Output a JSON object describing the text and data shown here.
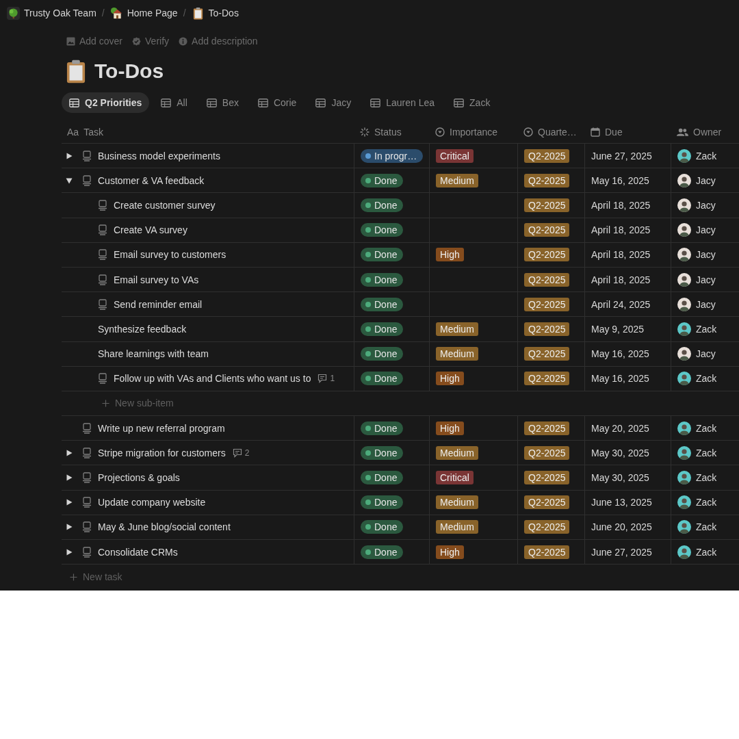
{
  "breadcrumbs": [
    {
      "label": "Trusty Oak Team"
    },
    {
      "label": "Home Page"
    },
    {
      "label": "To-Dos"
    }
  ],
  "separator": "/",
  "page_actions": [
    {
      "label": "Add cover"
    },
    {
      "label": "Verify"
    },
    {
      "label": "Add description"
    }
  ],
  "title": "To-Dos",
  "views": [
    {
      "label": "Q2 Priorities",
      "selected": true
    },
    {
      "label": "All",
      "selected": false
    },
    {
      "label": "Bex",
      "selected": false
    },
    {
      "label": "Corie",
      "selected": false
    },
    {
      "label": "Jacy",
      "selected": false
    },
    {
      "label": "Lauren Lea",
      "selected": false
    },
    {
      "label": "Zack",
      "selected": false
    }
  ],
  "columns": [
    {
      "label": "Task",
      "kind": "title",
      "icon_text": "Aa"
    },
    {
      "label": "Status",
      "kind": "status"
    },
    {
      "label": "Importance",
      "kind": "select"
    },
    {
      "label": "Quarte…",
      "kind": "select"
    },
    {
      "label": "Due",
      "kind": "date"
    },
    {
      "label": "Owner",
      "kind": "person"
    }
  ],
  "rows": [
    {
      "task": "Business model experiments",
      "expandable": true,
      "expanded": false,
      "page_icon": true,
      "status": {
        "label": "In progr…",
        "color": "#2b4c6b"
      },
      "importance": {
        "label": "Critical",
        "color": "#7a3535"
      },
      "quarter": "Q2-2025",
      "due": "June 27, 2025",
      "owner": {
        "name": "Zack",
        "color": "#5cc8c8"
      }
    },
    {
      "task": "Customer & VA feedback",
      "expandable": true,
      "expanded": true,
      "page_icon": true,
      "status": {
        "label": "Done",
        "color": "#2b593f"
      },
      "importance": {
        "label": "Medium",
        "color": "#89632a"
      },
      "quarter": "Q2-2025",
      "due": "May 16, 2025",
      "owner": {
        "name": "Jacy",
        "color": "#e8e0da"
      },
      "children": [
        {
          "task": "Create customer survey",
          "page_icon": true,
          "status": {
            "label": "Done",
            "color": "#2b593f"
          },
          "quarter": "Q2-2025",
          "due": "April 18, 2025",
          "owner": {
            "name": "Jacy",
            "color": "#e8e0da"
          }
        },
        {
          "task": "Create VA survey",
          "page_icon": true,
          "status": {
            "label": "Done",
            "color": "#2b593f"
          },
          "quarter": "Q2-2025",
          "due": "April 18, 2025",
          "owner": {
            "name": "Jacy",
            "color": "#e8e0da"
          }
        },
        {
          "task": "Email survey to customers",
          "page_icon": true,
          "status": {
            "label": "Done",
            "color": "#2b593f"
          },
          "importance": {
            "label": "High",
            "color": "#854c1d"
          },
          "quarter": "Q2-2025",
          "due": "April 18, 2025",
          "owner": {
            "name": "Jacy",
            "color": "#e8e0da"
          }
        },
        {
          "task": "Email survey to VAs",
          "page_icon": true,
          "status": {
            "label": "Done",
            "color": "#2b593f"
          },
          "quarter": "Q2-2025",
          "due": "April 18, 2025",
          "owner": {
            "name": "Jacy",
            "color": "#e8e0da"
          }
        },
        {
          "task": "Send reminder email",
          "page_icon": true,
          "status": {
            "label": "Done",
            "color": "#2b593f"
          },
          "quarter": "Q2-2025",
          "due": "April 24, 2025",
          "owner": {
            "name": "Jacy",
            "color": "#e8e0da"
          }
        },
        {
          "task": "Synthesize feedback",
          "page_icon": false,
          "status": {
            "label": "Done",
            "color": "#2b593f"
          },
          "importance": {
            "label": "Medium",
            "color": "#89632a"
          },
          "quarter": "Q2-2025",
          "due": "May 9, 2025",
          "owner": {
            "name": "Zack",
            "color": "#5cc8c8"
          }
        },
        {
          "task": "Share learnings with team",
          "page_icon": false,
          "status": {
            "label": "Done",
            "color": "#2b593f"
          },
          "importance": {
            "label": "Medium",
            "color": "#89632a"
          },
          "quarter": "Q2-2025",
          "due": "May 16, 2025",
          "owner": {
            "name": "Jacy",
            "color": "#e8e0da"
          }
        },
        {
          "task": "Follow up with VAs and Clients who want us to",
          "page_icon": true,
          "comments": "1",
          "status": {
            "label": "Done",
            "color": "#2b593f"
          },
          "importance": {
            "label": "High",
            "color": "#854c1d"
          },
          "quarter": "Q2-2025",
          "due": "May 16, 2025",
          "owner": {
            "name": "Zack",
            "color": "#5cc8c8"
          }
        }
      ],
      "new_sub_item": "New sub-item"
    },
    {
      "task": "Write up new referral program",
      "expandable": false,
      "page_icon": true,
      "status": {
        "label": "Done",
        "color": "#2b593f"
      },
      "importance": {
        "label": "High",
        "color": "#854c1d"
      },
      "quarter": "Q2-2025",
      "due": "May 20, 2025",
      "owner": {
        "name": "Zack",
        "color": "#5cc8c8"
      }
    },
    {
      "task": "Stripe migration for customers",
      "expandable": true,
      "expanded": false,
      "page_icon": true,
      "comments": "2",
      "status": {
        "label": "Done",
        "color": "#2b593f"
      },
      "importance": {
        "label": "Medium",
        "color": "#89632a"
      },
      "quarter": "Q2-2025",
      "due": "May 30, 2025",
      "owner": {
        "name": "Zack",
        "color": "#5cc8c8"
      }
    },
    {
      "task": "Projections & goals",
      "expandable": true,
      "expanded": false,
      "page_icon": true,
      "status": {
        "label": "Done",
        "color": "#2b593f"
      },
      "importance": {
        "label": "Critical",
        "color": "#7a3535"
      },
      "quarter": "Q2-2025",
      "due": "May 30, 2025",
      "owner": {
        "name": "Zack",
        "color": "#5cc8c8"
      }
    },
    {
      "task": "Update company website",
      "expandable": true,
      "expanded": false,
      "page_icon": true,
      "status": {
        "label": "Done",
        "color": "#2b593f"
      },
      "importance": {
        "label": "Medium",
        "color": "#89632a"
      },
      "quarter": "Q2-2025",
      "due": "June 13, 2025",
      "owner": {
        "name": "Zack",
        "color": "#5cc8c8"
      }
    },
    {
      "task": "May & June blog/social content",
      "expandable": true,
      "expanded": false,
      "page_icon": true,
      "status": {
        "label": "Done",
        "color": "#2b593f"
      },
      "importance": {
        "label": "Medium",
        "color": "#89632a"
      },
      "quarter": "Q2-2025",
      "due": "June 20, 2025",
      "owner": {
        "name": "Zack",
        "color": "#5cc8c8"
      }
    },
    {
      "task": "Consolidate CRMs",
      "expandable": true,
      "expanded": false,
      "page_icon": true,
      "status": {
        "label": "Done",
        "color": "#2b593f"
      },
      "importance": {
        "label": "High",
        "color": "#854c1d"
      },
      "quarter": "Q2-2025",
      "due": "June 27, 2025",
      "owner": {
        "name": "Zack",
        "color": "#5cc8c8"
      }
    }
  ],
  "new_task": "New task"
}
